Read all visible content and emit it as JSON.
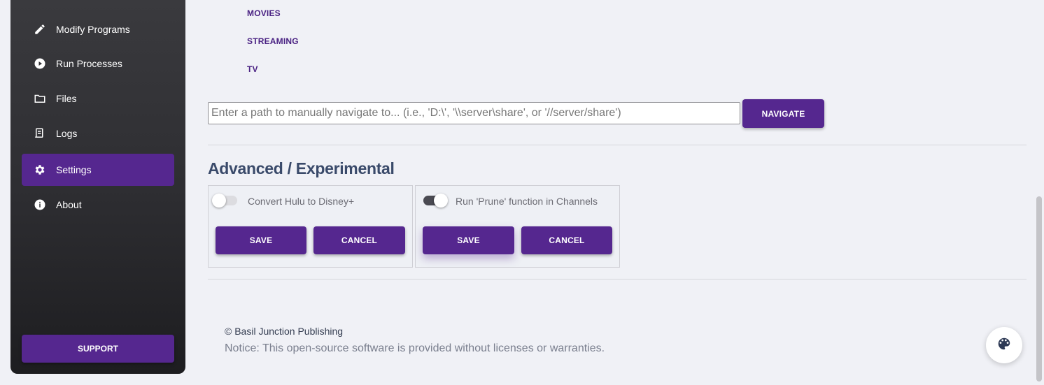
{
  "sidebar": {
    "items": [
      {
        "label": "Modify Programs",
        "icon": "pencil-icon"
      },
      {
        "label": "Run Processes",
        "icon": "play-circle-icon"
      },
      {
        "label": "Files",
        "icon": "folder-icon"
      },
      {
        "label": "Logs",
        "icon": "scroll-icon"
      },
      {
        "label": "Settings",
        "icon": "gear-icon",
        "active": true
      },
      {
        "label": "About",
        "icon": "info-icon"
      }
    ],
    "support_label": "SUPPORT"
  },
  "folders": [
    "MOVIES",
    "STREAMING",
    "TV"
  ],
  "navigate": {
    "placeholder": "Enter a path to manually navigate to... (i.e., 'D:\\', '\\\\server\\share', or '//server/share')",
    "button_label": "NAVIGATE"
  },
  "advanced": {
    "title": "Advanced / Experimental",
    "cards": [
      {
        "label": "Convert Hulu to Disney+",
        "enabled": false,
        "save_label": "SAVE",
        "cancel_label": "CANCEL"
      },
      {
        "label": "Run 'Prune' function in Channels",
        "enabled": true,
        "save_label": "SAVE",
        "cancel_label": "CANCEL"
      }
    ]
  },
  "footer": {
    "copyright": "© Basil Junction Publishing",
    "notice": "Notice: This open-source software is provided without licenses or warranties."
  },
  "colors": {
    "accent": "#55278f",
    "link": "#4a2283",
    "sidebar_dark": "#1d1d20"
  }
}
